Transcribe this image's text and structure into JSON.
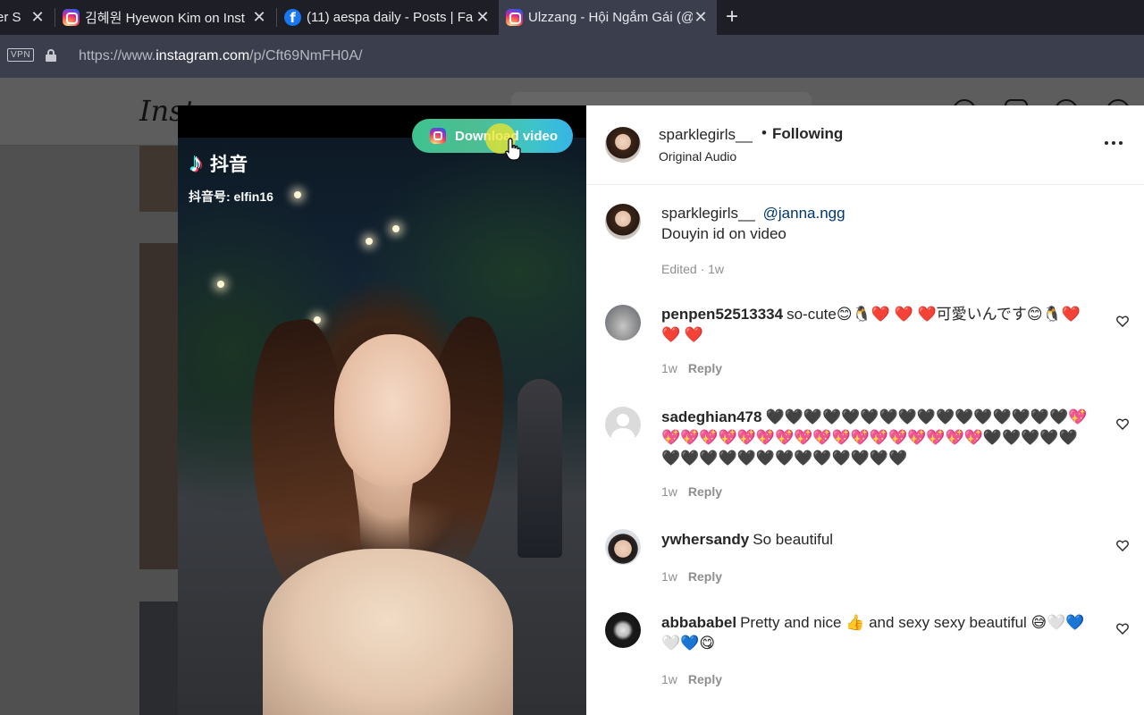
{
  "browser": {
    "tabs": [
      {
        "label": "er S",
        "icon": "none"
      },
      {
        "label": "김혜원 Hyewon Kim on Inst",
        "icon": "instagram-icon"
      },
      {
        "label": "(11) aespa daily - Posts | Fa",
        "icon": "facebook-icon"
      },
      {
        "label": "Ulzzang - Hội Ngắm Gái (@",
        "icon": "instagram-icon"
      }
    ],
    "new_tab": "+",
    "close_glyph": "✕",
    "vpn": "VPN",
    "url_prefix": "https://www.",
    "url_domain": "instagram.com",
    "url_path": "/p/Cft69NmFH0A/"
  },
  "background_page": {
    "logo": "Inst"
  },
  "video": {
    "platform_name": "抖音",
    "platform_id": "抖音号: elfin16",
    "download_button": "Download video"
  },
  "post": {
    "author": "sparklegirls__",
    "dot": "•",
    "follow_status": "Following",
    "audio": "Original Audio",
    "caption": {
      "user": "sparklegirls__",
      "mention": "@janna.ngg",
      "text": "Douyin id on video",
      "meta": "Edited · 1w"
    },
    "comments": [
      {
        "user": "penpen52513334",
        "text": "so-cute😊🐧❤️ ❤️ ❤️可愛いんです😊🐧❤️ ❤️ ❤️",
        "age": "1w",
        "reply": "Reply"
      },
      {
        "user": "sadeghian478",
        "text": "🖤🖤🖤🖤🖤🖤🖤🖤🖤🖤🖤🖤🖤🖤🖤🖤💖💖💖💖💖💖💖💖💖💖💖💖💖💖💖💖💖💖🖤🖤🖤🖤🖤🖤🖤🖤🖤🖤🖤🖤🖤🖤🖤🖤🖤🖤",
        "age": "1w",
        "reply": "Reply"
      },
      {
        "user": "ywhersandy",
        "text": "So beautiful",
        "age": "1w",
        "reply": "Reply"
      },
      {
        "user": "abbababel",
        "text": "Pretty and nice 👍 and sexy sexy beautiful 😅🤍💙🤍💙😋",
        "age": "1w",
        "reply": "Reply"
      }
    ]
  },
  "colors": {
    "download_gradient_start": "#3ec38f",
    "download_gradient_end": "#35b4e6",
    "mention": "#00376b",
    "muted": "#8e8e8e"
  }
}
